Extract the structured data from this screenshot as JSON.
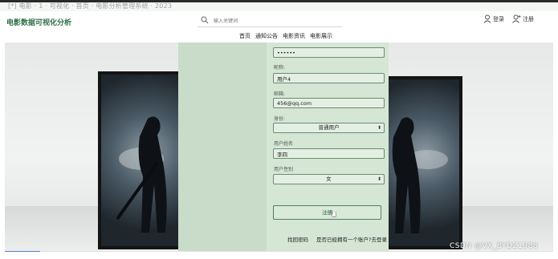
{
  "top_strip": {
    "faint_text": "[*] 电影 · 1 · 可视化 · 首页 · 电影分析管理系统 · 2023"
  },
  "header": {
    "site_title": "电影数据可视化分析",
    "search_placeholder": "输入关键词",
    "login_label": "登录",
    "register_label": "注册",
    "nav": [
      "首页",
      "通知公告",
      "电影资讯",
      "电影展示"
    ]
  },
  "form": {
    "password_value": "••••••",
    "nickname_label": "昵称:",
    "nickname_value": "用户4",
    "email_label": "邮箱:",
    "email_value": "456@qq.com",
    "identity_label": "身份:",
    "identity_value": "普通用户",
    "realname_label": "用户姓名",
    "realname_value": "李四",
    "gender_label": "用户性别",
    "gender_value": "女",
    "submit_label": "注册",
    "forgot_label": "找回密码",
    "have_account_label": "是否已经拥有一个账户?去登录"
  },
  "watermark": "CSDN @VX_BYDZ1988",
  "progress": {
    "fraction": 0.065,
    "color": "#5a7fbf"
  },
  "colors": {
    "brand_green": "#2e6f47",
    "panel_green": "#d5e6d5",
    "overlay_green": "#c9dcc9"
  },
  "icons": [
    "search-icon",
    "user-icon",
    "user-plus-icon",
    "dropdown-arrow-icon",
    "cursor-hand-icon"
  ]
}
